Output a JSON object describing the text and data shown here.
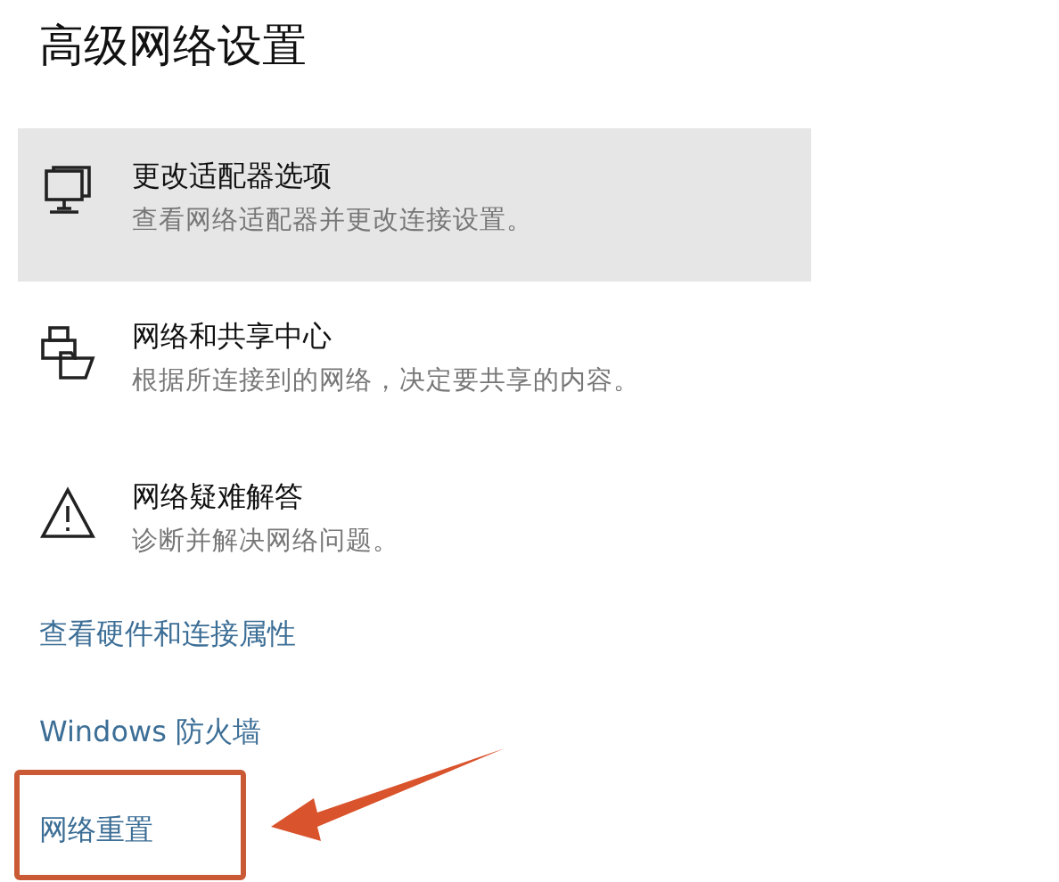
{
  "title": "高级网络设置",
  "options": [
    {
      "kind": "monitor",
      "title": "更改适配器选项",
      "description": "查看网络适配器并更改连接设置。",
      "highlighted": true
    },
    {
      "kind": "sharing",
      "title": "网络和共享中心",
      "description": "根据所连接到的网络，决定要共享的内容。",
      "highlighted": false
    },
    {
      "kind": "warning",
      "title": "网络疑难解答",
      "description": "诊断并解决网络问题。",
      "highlighted": false
    }
  ],
  "links": [
    "查看硬件和连接属性",
    "Windows 防火墙",
    "网络重置"
  ]
}
